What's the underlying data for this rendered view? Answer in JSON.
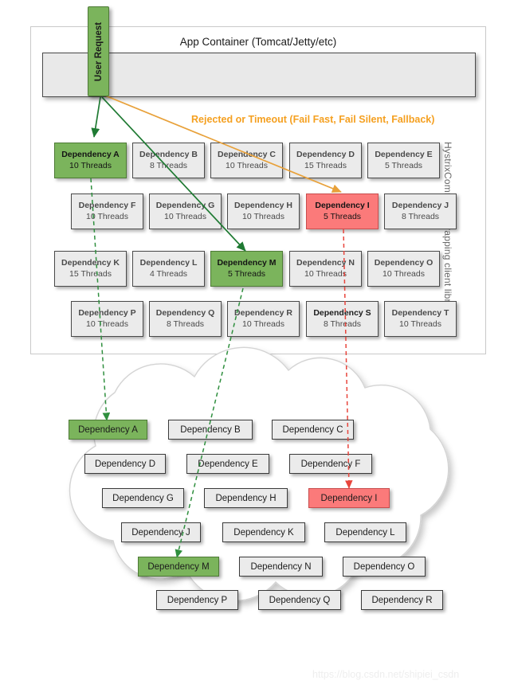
{
  "app_container": {
    "title": "App Container (Tomcat/Jetty/etc)",
    "side_caption": "HystrixCommand wrapping client libraries"
  },
  "user_request": {
    "label": "User Request"
  },
  "annotation": {
    "rejected_or_timeout": "Rejected or Timeout (Fail Fast, Fail Silent, Fallback)"
  },
  "thread_pools": [
    {
      "name": "Dependency A",
      "threads": "10 Threads",
      "state": "green"
    },
    {
      "name": "Dependency B",
      "threads": "8 Threads",
      "state": "normal"
    },
    {
      "name": "Dependency C",
      "threads": "10 Threads",
      "state": "normal"
    },
    {
      "name": "Dependency D",
      "threads": "15 Threads",
      "state": "normal"
    },
    {
      "name": "Dependency E",
      "threads": "5 Threads",
      "state": "normal"
    },
    {
      "name": "Dependency F",
      "threads": "10 Threads",
      "state": "normal"
    },
    {
      "name": "Dependency G",
      "threads": "10 Threads",
      "state": "normal"
    },
    {
      "name": "Dependency H",
      "threads": "10 Threads",
      "state": "normal"
    },
    {
      "name": "Dependency I",
      "threads": "5 Threads",
      "state": "red"
    },
    {
      "name": "Dependency J",
      "threads": "8 Threads",
      "state": "normal"
    },
    {
      "name": "Dependency K",
      "threads": "15 Threads",
      "state": "normal"
    },
    {
      "name": "Dependency L",
      "threads": "4 Threads",
      "state": "normal"
    },
    {
      "name": "Dependency M",
      "threads": "5 Threads",
      "state": "green"
    },
    {
      "name": "Dependency N",
      "threads": "10 Threads",
      "state": "normal"
    },
    {
      "name": "Dependency O",
      "threads": "10 Threads",
      "state": "normal"
    },
    {
      "name": "Dependency P",
      "threads": "10 Threads",
      "state": "normal"
    },
    {
      "name": "Dependency Q",
      "threads": "8 Threads",
      "state": "normal"
    },
    {
      "name": "Dependency R",
      "threads": "10 Threads",
      "state": "normal"
    },
    {
      "name": "Dependency S",
      "threads": "8 Threads",
      "state": "dark"
    },
    {
      "name": "Dependency T",
      "threads": "10 Threads",
      "state": "normal"
    }
  ],
  "cloud_services": [
    {
      "name": "Dependency A",
      "state": "green"
    },
    {
      "name": "Dependency B",
      "state": "normal"
    },
    {
      "name": "Dependency C",
      "state": "normal"
    },
    {
      "name": "Dependency D",
      "state": "normal"
    },
    {
      "name": "Dependency E",
      "state": "normal"
    },
    {
      "name": "Dependency F",
      "state": "normal"
    },
    {
      "name": "Dependency G",
      "state": "normal"
    },
    {
      "name": "Dependency H",
      "state": "normal"
    },
    {
      "name": "Dependency I",
      "state": "red"
    },
    {
      "name": "Dependency J",
      "state": "normal"
    },
    {
      "name": "Dependency K",
      "state": "normal"
    },
    {
      "name": "Dependency L",
      "state": "normal"
    },
    {
      "name": "Dependency M",
      "state": "green"
    },
    {
      "name": "Dependency N",
      "state": "normal"
    },
    {
      "name": "Dependency O",
      "state": "normal"
    },
    {
      "name": "Dependency P",
      "state": "normal"
    },
    {
      "name": "Dependency Q",
      "state": "normal"
    },
    {
      "name": "Dependency R",
      "state": "normal"
    }
  ],
  "watermark": {
    "text": "https://blog.csdn.net/shipiei_csdn"
  },
  "colors": {
    "healthy_green": "#7bb45c",
    "failing_red": "#fb7a7a",
    "neutral_gray": "#ebebeb",
    "warning_orange": "#F5A020"
  }
}
